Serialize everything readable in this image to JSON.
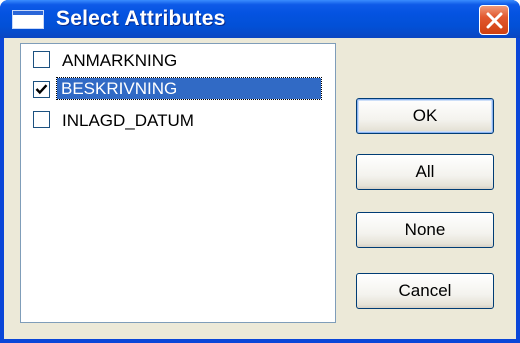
{
  "window": {
    "title": "Select Attributes",
    "icon": "window-icon",
    "close_icon": "close-icon"
  },
  "attributes": [
    {
      "label": "ANMARKNING",
      "checked": false,
      "selected": false
    },
    {
      "label": "BESKRIVNING",
      "checked": true,
      "selected": true
    },
    {
      "label": "INLAGD_DATUM",
      "checked": false,
      "selected": false
    }
  ],
  "buttons": {
    "ok": "OK",
    "all": "All",
    "none": "None",
    "cancel": "Cancel"
  },
  "colors": {
    "title_bar": "#0453e1",
    "selection": "#316ac5",
    "dialog_face": "#ece9d8"
  }
}
